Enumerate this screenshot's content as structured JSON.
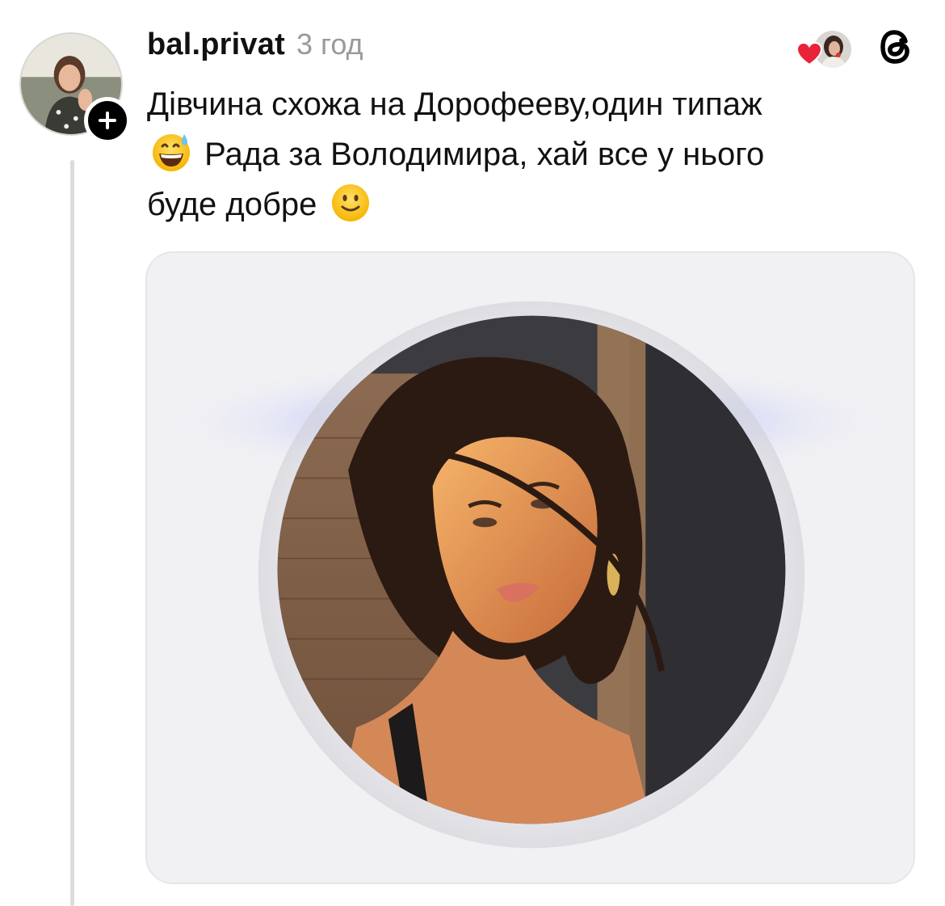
{
  "post": {
    "username": "bal.privat",
    "time": "3 год",
    "text_line1": "Дівчина схожа на Дорофееву,один типаж",
    "text_line2": "Рада за Володимира, хай все у нього",
    "text_line3": "буде добре"
  },
  "icons": {
    "follow": "plus-icon",
    "like": "heart-icon",
    "app": "threads-logo-icon",
    "emoji_1": "grinning-sweat-emoji",
    "emoji_2": "slightly-smiling-emoji"
  },
  "colors": {
    "heart": "#e8233a",
    "username": "#111111",
    "time": "#9a9a9a",
    "thread_line": "#dcdcdc",
    "card_glow": "#b4bcf5"
  }
}
